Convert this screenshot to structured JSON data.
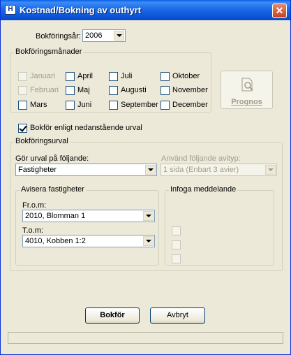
{
  "window": {
    "title": "Kostnad/Bokning av outhyrt",
    "app_icon": "H"
  },
  "bokforingsar": {
    "label": "Bokföringsår:",
    "value": "2006"
  },
  "bokforingsmanader": {
    "legend": "Bokföringsmånader",
    "months": [
      {
        "label": "Januari",
        "checked": false,
        "disabled": true
      },
      {
        "label": "Februari",
        "checked": false,
        "disabled": true
      },
      {
        "label": "Mars",
        "checked": false,
        "disabled": false
      },
      {
        "label": "April",
        "checked": false,
        "disabled": false
      },
      {
        "label": "Maj",
        "checked": false,
        "disabled": false
      },
      {
        "label": "Juni",
        "checked": false,
        "disabled": false
      },
      {
        "label": "Juli",
        "checked": false,
        "disabled": false
      },
      {
        "label": "Augusti",
        "checked": false,
        "disabled": false
      },
      {
        "label": "September",
        "checked": false,
        "disabled": false
      },
      {
        "label": "Oktober",
        "checked": false,
        "disabled": false
      },
      {
        "label": "November",
        "checked": false,
        "disabled": false
      },
      {
        "label": "December",
        "checked": false,
        "disabled": false
      }
    ]
  },
  "prognos": {
    "label": "Prognos",
    "icon": "search-document-icon"
  },
  "bokfor_urval": {
    "label": "Bokför enligt nedanstående urval",
    "checked": true
  },
  "bokforingsurval": {
    "legend": "Bokföringsurval",
    "gor_urval": {
      "label": "Gör urval på följande:",
      "value": "Fastigheter"
    },
    "avityp": {
      "label": "Använd följande avityp:",
      "value": "1 sida (Enbart 3 avier)"
    },
    "avisera": {
      "legend": "Avisera fastigheter",
      "from_label": "Fr.o.m:",
      "from_value": "2010, Blomman 1",
      "to_label": "T.o.m:",
      "to_value": "4010, Kobben 1:2"
    },
    "infoga": {
      "legend": "Infoga meddelande"
    }
  },
  "buttons": {
    "bokfor": "Bokför",
    "avbryt": "Avbryt"
  }
}
